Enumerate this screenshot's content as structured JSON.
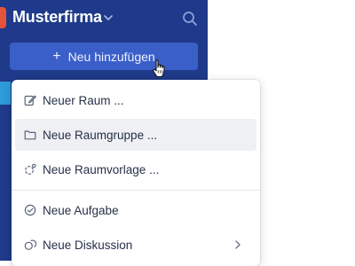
{
  "header": {
    "org_name": "Musterfirma"
  },
  "sidebar": {
    "add_button_label": "Neu hinzufügen"
  },
  "menu": {
    "items": [
      {
        "label": "Neuer Raum ...",
        "icon": "edit-icon"
      },
      {
        "label": "Neue Raumgruppe ...",
        "icon": "folder-icon",
        "hovered": true
      },
      {
        "label": "Neue Raumvorlage ...",
        "icon": "template-icon"
      },
      {
        "label": "Neue Aufgabe",
        "icon": "check-circle-icon"
      },
      {
        "label": "Neue Diskussion",
        "icon": "discussion-icon",
        "has_submenu": true
      }
    ]
  },
  "colors": {
    "sidebar_bg": "#1f3a8a",
    "button_bg": "#3b5fc8",
    "logo_accent": "#e5533b",
    "hover_bg": "#eef0f4"
  }
}
